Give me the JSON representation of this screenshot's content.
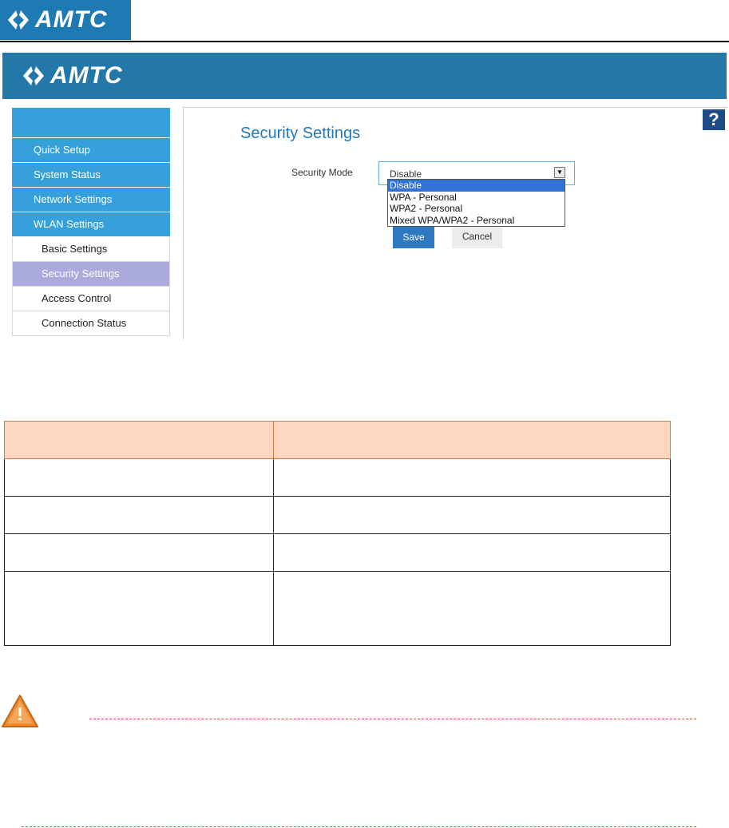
{
  "brand": {
    "name": "AMTC"
  },
  "router_ui": {
    "page_title": "Security Settings",
    "help_label": "?",
    "sidebar": {
      "items": [
        {
          "label": "Quick Setup"
        },
        {
          "label": "System Status"
        },
        {
          "label": "Network Settings"
        },
        {
          "label": "WLAN Settings"
        }
      ],
      "sub_items": [
        {
          "label": "Basic Settings",
          "active": false
        },
        {
          "label": "Security Settings",
          "active": true
        },
        {
          "label": "Access Control",
          "active": false
        },
        {
          "label": "Connection Status",
          "active": false
        }
      ]
    },
    "security_mode": {
      "label": "Security Mode",
      "value": "Disable",
      "options": [
        "Disable",
        "WPA - Personal",
        "WPA2 - Personal",
        "Mixed WPA/WPA2 - Personal"
      ]
    },
    "buttons": {
      "save": "Save",
      "cancel": "Cancel"
    }
  },
  "colors": {
    "banner": "#2478a8",
    "sidebar": "#35a0da",
    "active_item": "#aaaadd",
    "title": "#1f79bf",
    "save_button": "#2f79c0",
    "table_header": "#fdd7bf",
    "warning": "#f08a2a",
    "dash": "#d94a3f"
  },
  "icons": {
    "logo": "amtc-logo-icon",
    "warning": "warning-triangle-icon"
  }
}
